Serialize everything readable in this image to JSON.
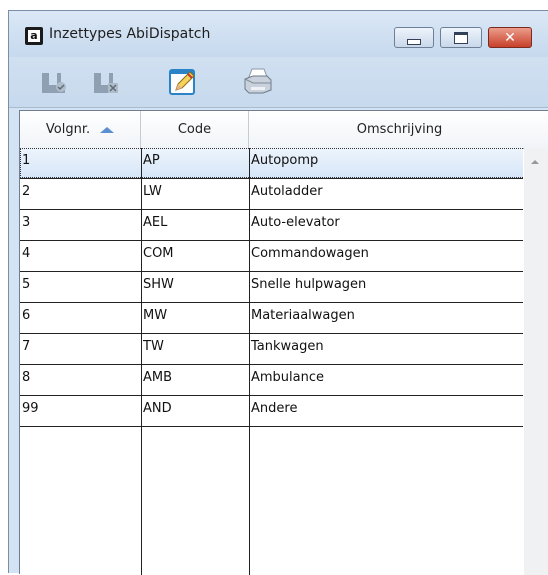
{
  "window": {
    "icon_letter": "a",
    "title": "Inzettypes AbiDispatch"
  },
  "title_controls": {
    "minimize": "minimize",
    "maximize": "maximize",
    "close": "close"
  },
  "toolbar": {
    "buttons": [
      "confirm-disabled-icon",
      "delete-disabled-icon",
      "edit-icon",
      "print-icon"
    ]
  },
  "table": {
    "columns": [
      "Volgnr.",
      "Code",
      "Omschrijving"
    ],
    "sort_column": "Volgnr.",
    "rows": [
      {
        "nr": "1",
        "code": "AP",
        "desc": "Autopomp"
      },
      {
        "nr": "2",
        "code": "LW",
        "desc": "Autoladder"
      },
      {
        "nr": "3",
        "code": "AEL",
        "desc": "Auto-elevator"
      },
      {
        "nr": "4",
        "code": "COM",
        "desc": "Commandowagen"
      },
      {
        "nr": "5",
        "code": "SHW",
        "desc": "Snelle hulpwagen"
      },
      {
        "nr": "6",
        "code": "MW",
        "desc": "Materiaalwagen"
      },
      {
        "nr": "7",
        "code": "TW",
        "desc": "Tankwagen"
      },
      {
        "nr": "8",
        "code": "AMB",
        "desc": "Ambulance"
      },
      {
        "nr": "99",
        "code": "AND",
        "desc": "Andere"
      }
    ]
  },
  "colors": {
    "chrome": "#d3e3f3",
    "selected_row": "#dce9f8",
    "close_button": "#c7402a"
  }
}
